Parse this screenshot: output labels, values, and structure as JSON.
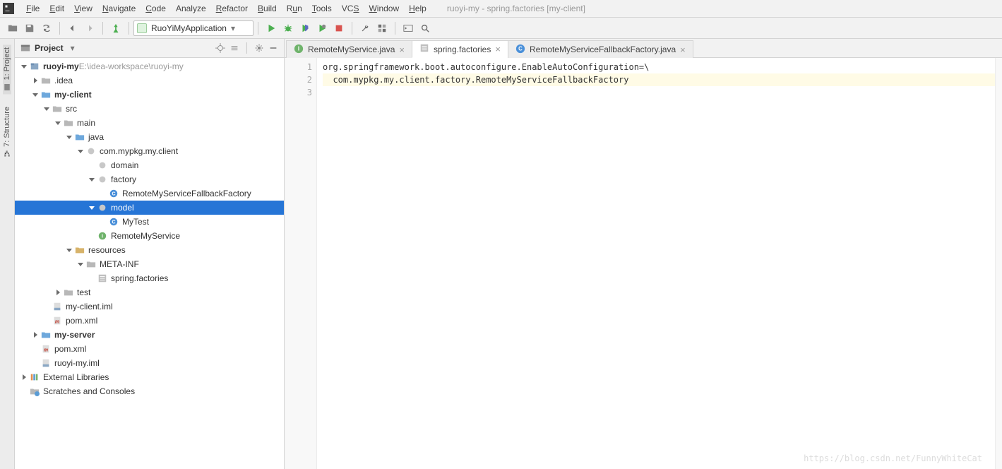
{
  "title": {
    "project": "ruoyi-my",
    "file": "spring.factories",
    "module": "my-client"
  },
  "menu": [
    "File",
    "Edit",
    "View",
    "Navigate",
    "Code",
    "Analyze",
    "Refactor",
    "Build",
    "Run",
    "Tools",
    "VCS",
    "Window",
    "Help"
  ],
  "menu_underline": [
    0,
    0,
    0,
    0,
    0,
    -1,
    0,
    0,
    1,
    0,
    2,
    0,
    0
  ],
  "toolbar": {
    "run_config_label": "RuoYiMyApplication"
  },
  "side_tabs": {
    "project": "1: Project",
    "structure": "7: Structure"
  },
  "project_panel": {
    "title": "Project"
  },
  "tree": {
    "root": {
      "name": "ruoyi-my",
      "path": "E:\\idea-workspace\\ruoyi-my"
    },
    "items": {
      "idea": ".idea",
      "my_client": "my-client",
      "src": "src",
      "main": "main",
      "java": "java",
      "pkg": "com.mypkg.my.client",
      "domain": "domain",
      "factory": "factory",
      "fallback": "RemoteMyServiceFallbackFactory",
      "model": "model",
      "mytest": "MyTest",
      "remote_svc": "RemoteMyService",
      "resources": "resources",
      "metainf": "META-INF",
      "springfactories": "spring.factories",
      "test": "test",
      "my_client_iml": "my-client.iml",
      "pom1": "pom.xml",
      "my_server": "my-server",
      "pom2": "pom.xml",
      "ruoyi_iml": "ruoyi-my.iml",
      "ext_lib": "External Libraries",
      "scratches": "Scratches and Consoles"
    }
  },
  "tabs": [
    {
      "icon": "interface",
      "label": "RemoteMyService.java",
      "active": false
    },
    {
      "icon": "props",
      "label": "spring.factories",
      "active": true
    },
    {
      "icon": "class",
      "label": "RemoteMyServiceFallbackFactory.java",
      "active": false
    }
  ],
  "editor": {
    "lines": [
      "org.springframework.boot.autoconfigure.EnableAutoConfiguration=\\",
      "  com.mypkg.my.client.factory.RemoteMyServiceFallbackFactory",
      ""
    ],
    "caret_line": 2
  },
  "watermark": "https://blog.csdn.net/FunnyWhiteCat"
}
